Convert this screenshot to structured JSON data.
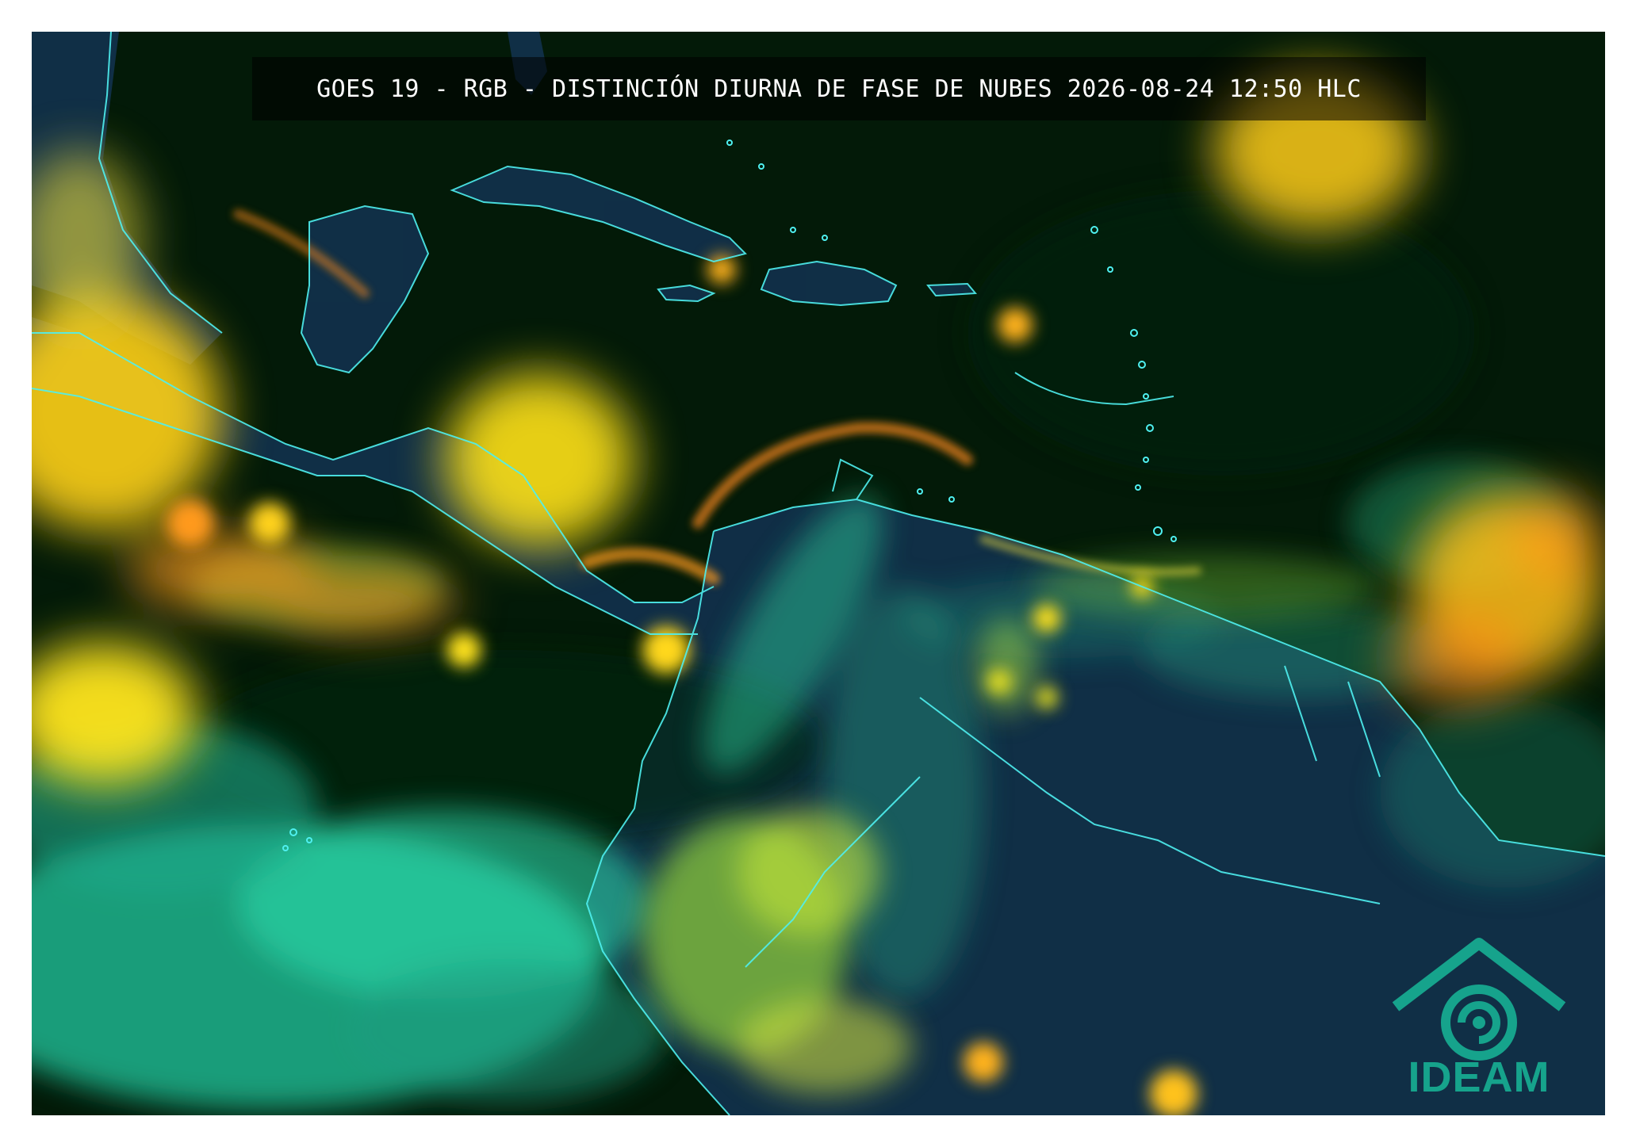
{
  "image": {
    "title": "GOES 19 - RGB - DISTINCIÓN DIURNA DE FASE DE NUBES 2026-08-24 12:50 HLC",
    "logo_text": "IDEAM",
    "logo_icon": "ideam-mountain-swirl-icon",
    "colors": {
      "background": "#031a08",
      "coastline": "#4ff0f0",
      "ice_cloud": "#ffee33",
      "mixed_cloud": "#ff8c1a",
      "water_cloud": "#2ee0b0",
      "land": "#12304a",
      "logo": "#16a38c"
    }
  }
}
